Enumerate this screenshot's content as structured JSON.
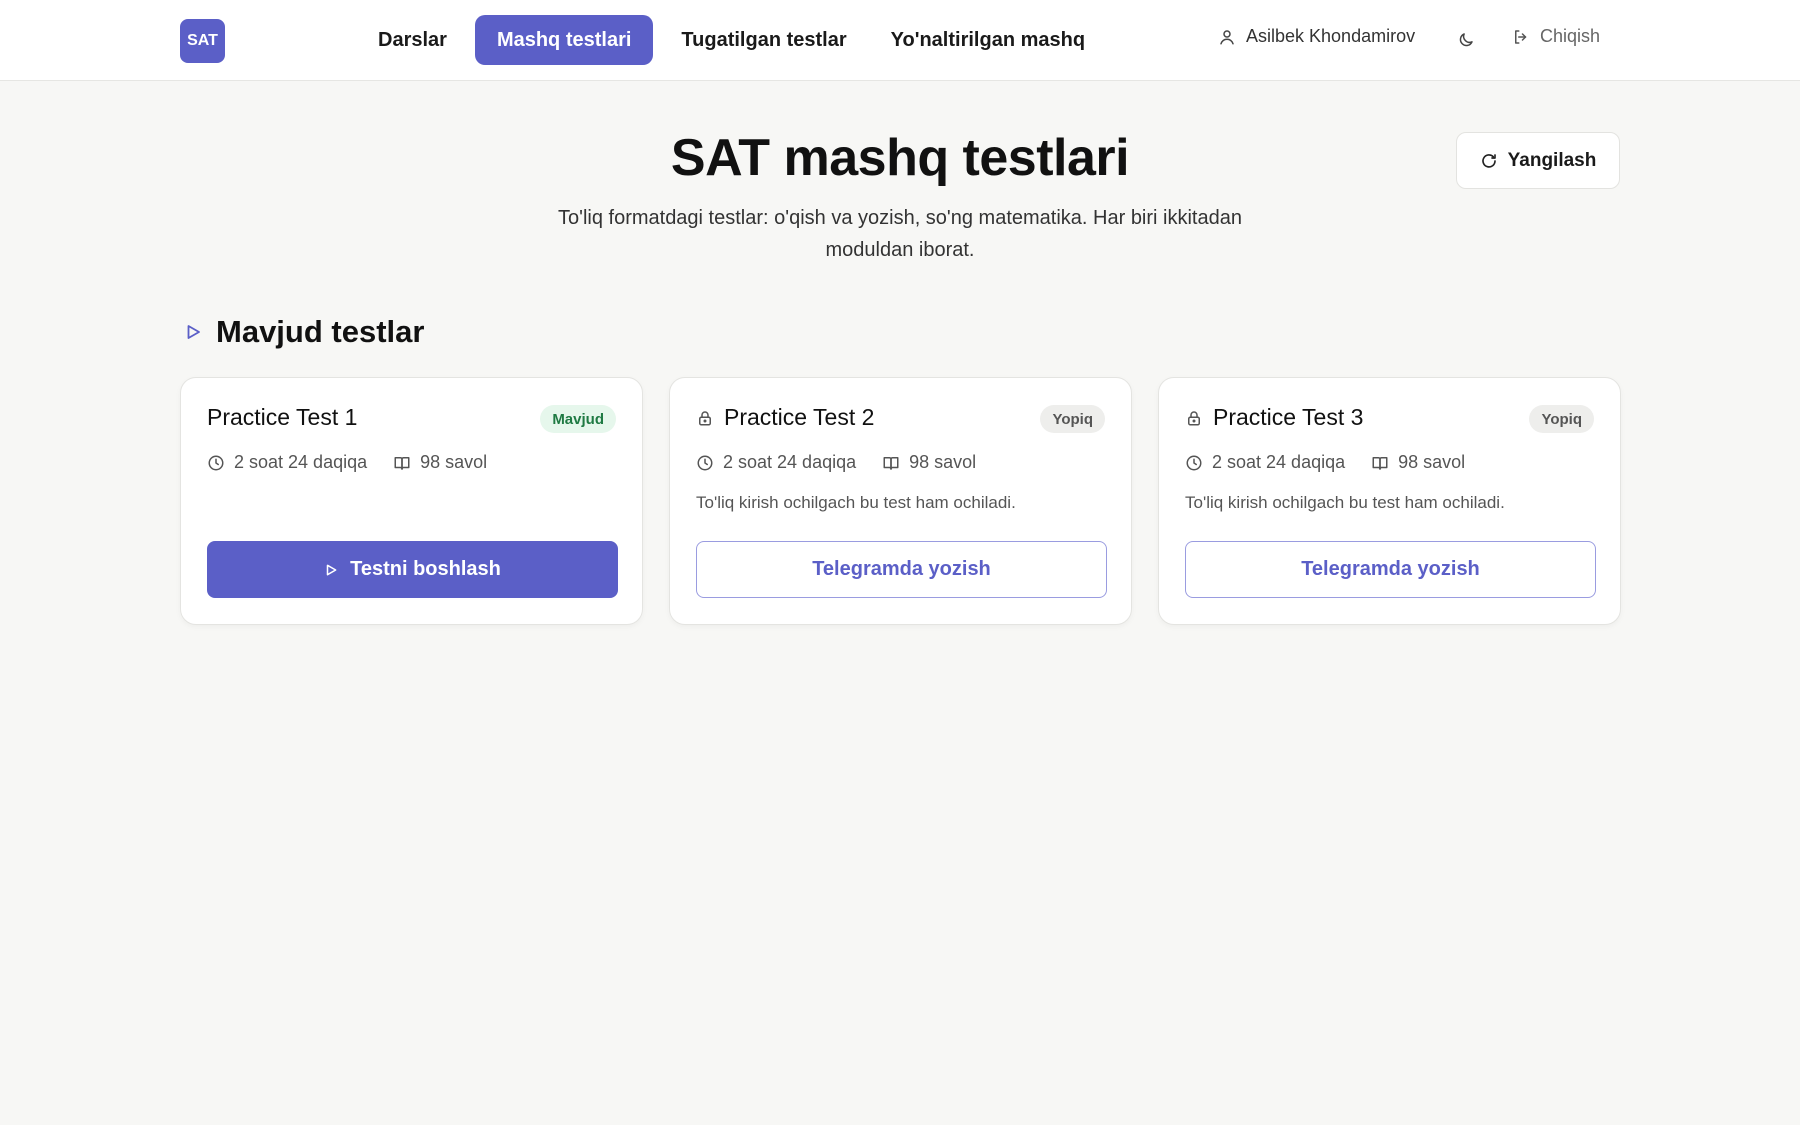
{
  "header": {
    "logo": "SAT",
    "nav": [
      {
        "label": "Darslar"
      },
      {
        "label": "Mashq testlari",
        "active": true
      },
      {
        "label": "Tugatilgan testlar"
      },
      {
        "label": "Yo'naltirilgan mashq"
      }
    ],
    "user_name": "Asilbek Khondamirov",
    "logout_label": "Chiqish"
  },
  "hero": {
    "title": "SAT mashq testlari",
    "subtitle": "To'liq formatdagi testlar: o'qish va yozish, so'ng matematika. Har biri ikkitadan moduldan iborat.",
    "refresh_label": "Yangilash"
  },
  "section": {
    "title": "Mavjud testlar"
  },
  "cards": [
    {
      "title": "Practice Test 1",
      "locked": false,
      "badge": "Mavjud",
      "duration": "2 soat 24 daqiqa",
      "questions": "98 savol",
      "description": "",
      "button": "Testni boshlash"
    },
    {
      "title": "Practice Test 2",
      "locked": true,
      "badge": "Yopiq",
      "duration": "2 soat 24 daqiqa",
      "questions": "98 savol",
      "description": "To'liq kirish ochilgach bu test ham ochiladi.",
      "button": "Telegramda yozish"
    },
    {
      "title": "Practice Test 3",
      "locked": true,
      "badge": "Yopiq",
      "duration": "2 soat 24 daqiqa",
      "questions": "98 savol",
      "description": "To'liq kirish ochilgach bu test ham ochiladi.",
      "button": "Telegramda yozish"
    }
  ],
  "colors": {
    "accent": "#5b5fc7",
    "background": "#f7f7f5",
    "badge_available_bg": "#e6f7ec",
    "badge_available_text": "#1f7a43",
    "badge_locked_bg": "#eeeeec"
  }
}
